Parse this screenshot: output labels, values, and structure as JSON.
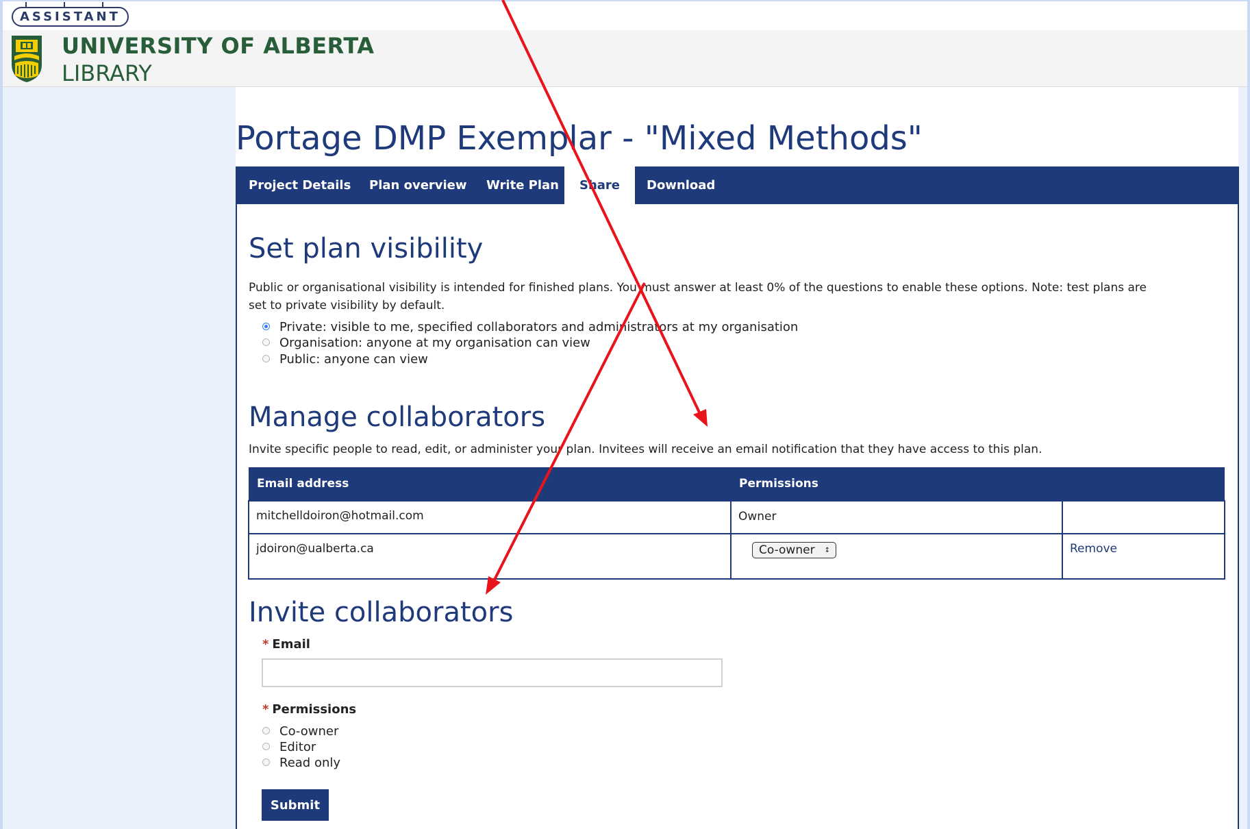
{
  "badge": {
    "label": "ASSISTANT"
  },
  "header": {
    "institution": "UNIVERSITY OF ALBERTA",
    "unit": "LIBRARY"
  },
  "plan": {
    "title": "Portage DMP Exemplar - \"Mixed Methods\""
  },
  "tabs": [
    {
      "label": "Project Details"
    },
    {
      "label": "Plan overview"
    },
    {
      "label": "Write Plan"
    },
    {
      "label": "Share",
      "active": true
    },
    {
      "label": "Download"
    }
  ],
  "visibility": {
    "heading": "Set plan visibility",
    "description_line1": "Public or organisational visibility is intended for finished plans. You must answer at least 0% of the questions to enable these options. Note: test plans are",
    "description_line2": "set to private visibility by default.",
    "options": [
      {
        "label": "Private: visible to me, specified collaborators and administrators at my organisation",
        "checked": true
      },
      {
        "label": "Organisation: anyone at my organisation can view",
        "checked": false
      },
      {
        "label": "Public: anyone can view",
        "checked": false
      }
    ]
  },
  "collaborators": {
    "heading": "Manage collaborators",
    "description": "Invite specific people to read, edit, or administer your plan. Invitees will receive an email notification that they have access to this plan.",
    "columns": {
      "email": "Email address",
      "permissions": "Permissions"
    },
    "rows": [
      {
        "email": "mitchelldoiron@hotmail.com",
        "permission": "Owner",
        "action": ""
      },
      {
        "email": "jdoiron@ualberta.ca",
        "permission": "Co-owner",
        "action": "Remove"
      }
    ]
  },
  "invite": {
    "heading": "Invite collaborators",
    "email_label": "Email",
    "email_value": "",
    "permissions_label": "Permissions",
    "required_marker": "*",
    "permission_options": [
      {
        "label": "Co-owner"
      },
      {
        "label": "Editor"
      },
      {
        "label": "Read only"
      }
    ],
    "submit_label": "Submit"
  },
  "colors": {
    "brand_navy": "#1e3a7b",
    "brand_green": "#275d38",
    "annotation_red": "#e8141b",
    "radio_blue": "#2f7ff0"
  }
}
